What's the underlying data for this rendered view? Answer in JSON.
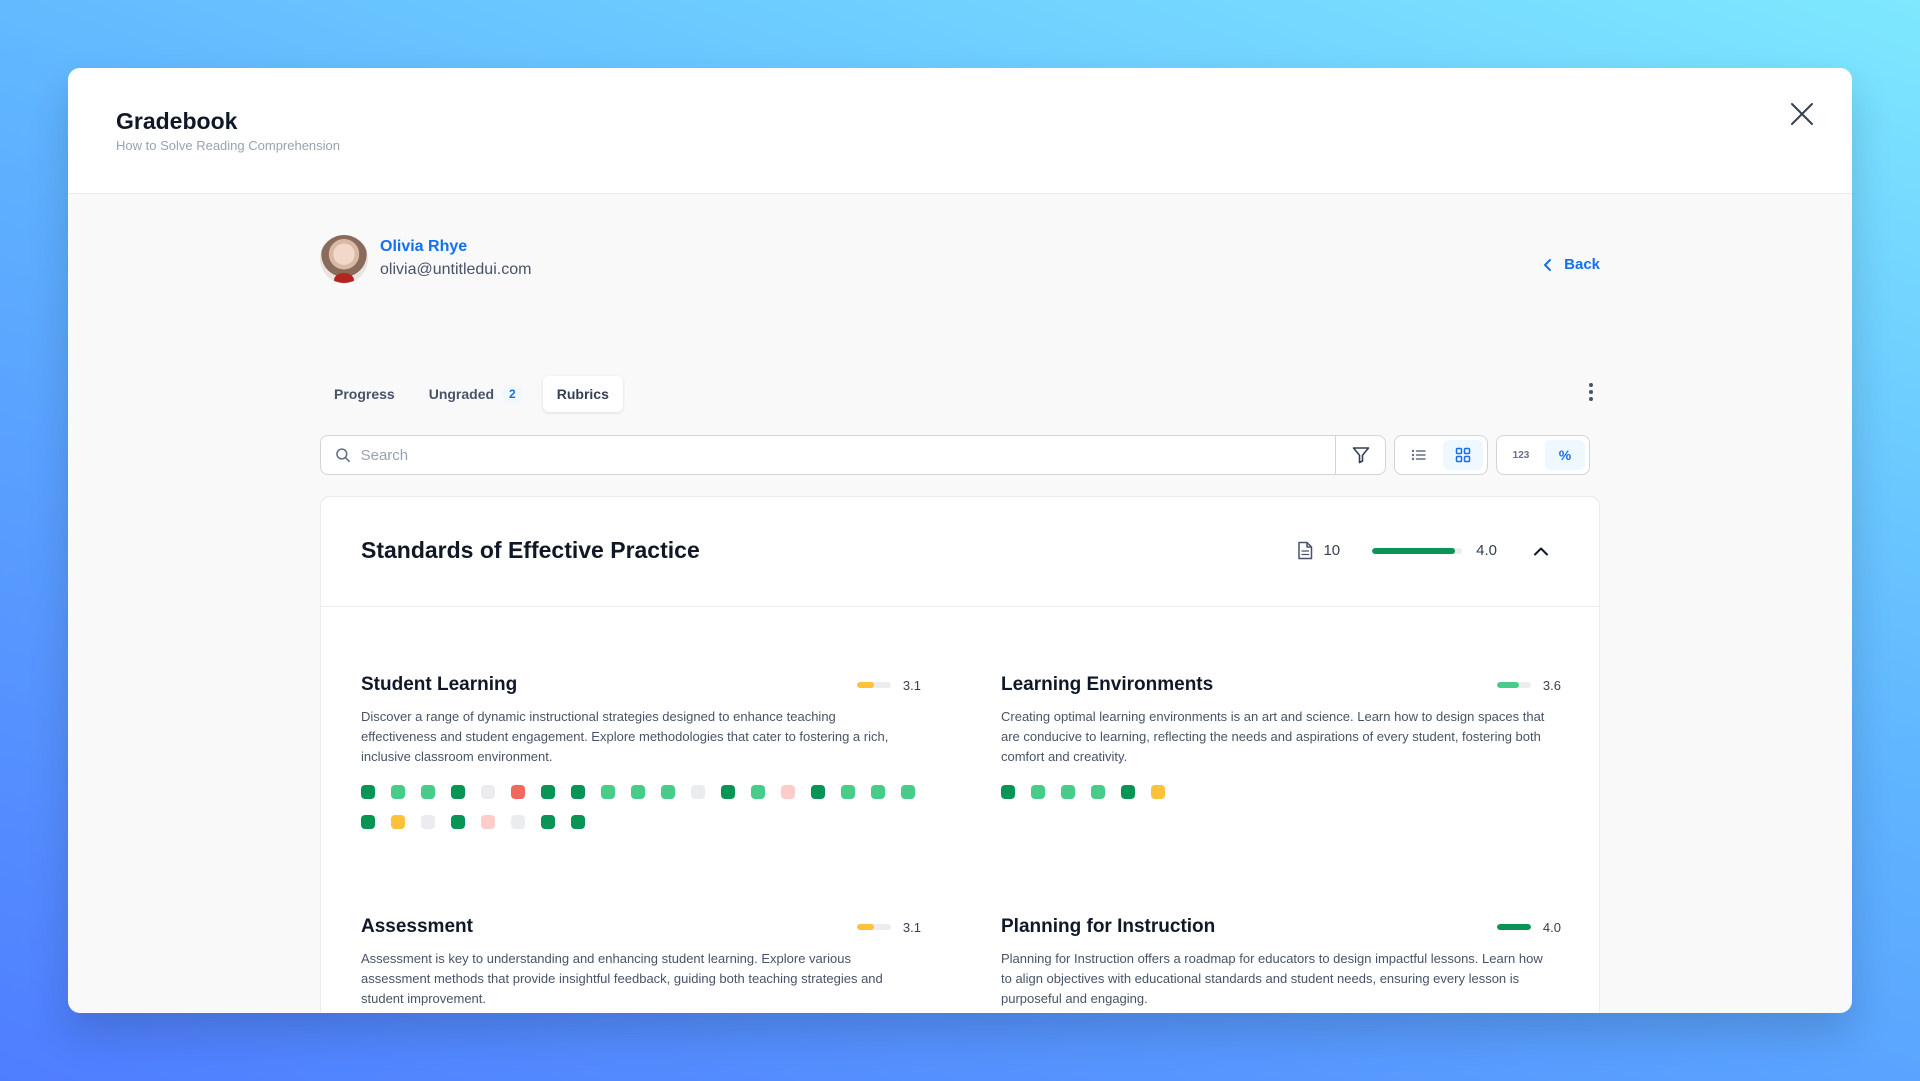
{
  "header": {
    "title": "Gradebook",
    "subtitle": "How to Solve Reading Comprehension"
  },
  "user": {
    "name": "Olivia Rhye",
    "email": "olivia@untitledui.com"
  },
  "back_label": "Back",
  "tabs": [
    {
      "label": "Progress",
      "badge": ""
    },
    {
      "label": "Ungraded",
      "badge": "2"
    },
    {
      "label": "Rubrics",
      "badge": ""
    }
  ],
  "search": {
    "placeholder": "Search"
  },
  "view_toggles": {
    "numeric_label": "123",
    "percent_label": "%"
  },
  "section": {
    "title": "Standards of Effective Practice",
    "count": "10",
    "score": "4.0",
    "progress": 0.92
  },
  "colors": {
    "dark": "#079455",
    "medium": "#47cd89",
    "yellow": "#fdc13a",
    "red": "#f0695c",
    "pink": "#fecdca",
    "gray": "#eaecf0"
  },
  "rubrics": [
    {
      "title": "Student Learning",
      "score": "3.1",
      "progress": 0.5,
      "bar_color": "#fdc13a",
      "description": "Discover a range of dynamic instructional strategies designed to enhance teaching effectiveness and student engagement. Explore methodologies that cater to fostering a rich, inclusive classroom environment.",
      "dots": [
        "dark",
        "medium",
        "medium",
        "dark",
        "gray",
        "red",
        "dark",
        "dark",
        "medium",
        "medium",
        "medium",
        "gray",
        "dark",
        "medium",
        "pink",
        "dark",
        "medium",
        "medium",
        "medium",
        "dark",
        "yellow",
        "gray",
        "dark",
        "pink",
        "gray",
        "dark",
        "dark"
      ]
    },
    {
      "title": "Learning Environments",
      "score": "3.6",
      "progress": 0.65,
      "bar_color": "#47cd89",
      "description": "Creating optimal learning environments is an art and science. Learn how to design spaces that are conducive to learning, reflecting the needs and aspirations of every student, fostering both comfort and creativity.",
      "dots": [
        "dark",
        "medium",
        "medium",
        "medium",
        "dark",
        "yellow"
      ]
    },
    {
      "title": "Assessment",
      "score": "3.1",
      "progress": 0.5,
      "bar_color": "#fdc13a",
      "description": "Assessment is key to understanding and enhancing student learning. Explore various assessment methods that provide insightful feedback, guiding both teaching strategies and student improvement.",
      "dots": [
        "medium",
        "gray",
        "dark",
        "medium",
        "pink",
        "dark",
        "yellow"
      ]
    },
    {
      "title": "Planning for Instruction",
      "score": "4.0",
      "progress": 1.0,
      "bar_color": "#079455",
      "description": "Planning for Instruction offers a roadmap for educators to design impactful lessons. Learn how to align objectives with educational standards and student needs, ensuring every lesson is purposeful and engaging.",
      "dots": [
        "dark",
        "medium",
        "medium",
        "medium",
        "dark",
        "yellow",
        "gray",
        "dark",
        "pink",
        "gray",
        "dark",
        "dark"
      ]
    }
  ]
}
